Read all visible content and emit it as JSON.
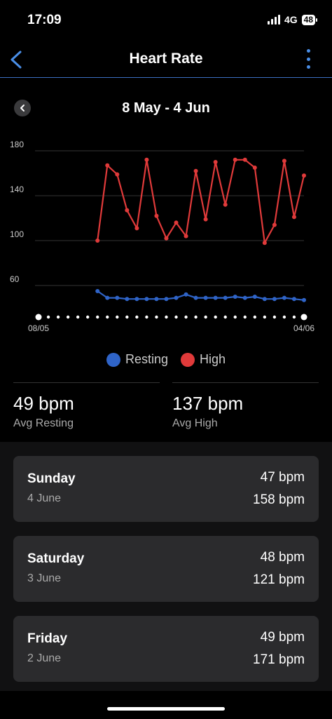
{
  "status_bar": {
    "time": "17:09",
    "network": "4G",
    "battery": "48"
  },
  "header": {
    "title": "Heart Rate"
  },
  "range": {
    "title": "8 May - 4 Jun"
  },
  "colors": {
    "resting": "#2f64c8",
    "high": "#e03a3a",
    "accent": "#4a8fe8"
  },
  "chart_data": {
    "type": "line",
    "x_start_label": "08/05",
    "x_end_label": "04/06",
    "x_dates": [
      "08/05",
      "09/05",
      "10/05",
      "11/05",
      "12/05",
      "13/05",
      "14/05",
      "15/05",
      "16/05",
      "17/05",
      "18/05",
      "19/05",
      "20/05",
      "21/05",
      "22/05",
      "23/05",
      "24/05",
      "25/05",
      "26/05",
      "27/05",
      "28/05",
      "29/05",
      "30/05",
      "31/05",
      "01/06",
      "02/06",
      "03/06",
      "04/06"
    ],
    "y_ticks": [
      60,
      100,
      140,
      180
    ],
    "ylim": [
      47,
      185
    ],
    "grid": true,
    "series": [
      {
        "name": "Resting",
        "values": [
          null,
          null,
          null,
          null,
          null,
          null,
          55,
          49,
          49,
          48,
          48,
          48,
          48,
          48,
          49,
          52,
          49,
          49,
          49,
          49,
          50,
          49,
          50,
          48,
          48,
          49,
          48,
          47
        ]
      },
      {
        "name": "High",
        "values": [
          null,
          null,
          null,
          null,
          null,
          null,
          100,
          167,
          159,
          127,
          111,
          172,
          122,
          102,
          116,
          104,
          162,
          119,
          170,
          132,
          172,
          172,
          165,
          98,
          114,
          171,
          121,
          158
        ]
      }
    ]
  },
  "legend": {
    "resting": "Resting",
    "high": "High"
  },
  "stats": {
    "avg_resting_value": "49 bpm",
    "avg_resting_label": "Avg Resting",
    "avg_high_value": "137 bpm",
    "avg_high_label": "Avg High"
  },
  "days": [
    {
      "day": "Sunday",
      "date": "4 June",
      "resting": "47 bpm",
      "high": "158 bpm"
    },
    {
      "day": "Saturday",
      "date": "3 June",
      "resting": "48 bpm",
      "high": "121 bpm"
    },
    {
      "day": "Friday",
      "date": "2 June",
      "resting": "49 bpm",
      "high": "171 bpm"
    }
  ]
}
